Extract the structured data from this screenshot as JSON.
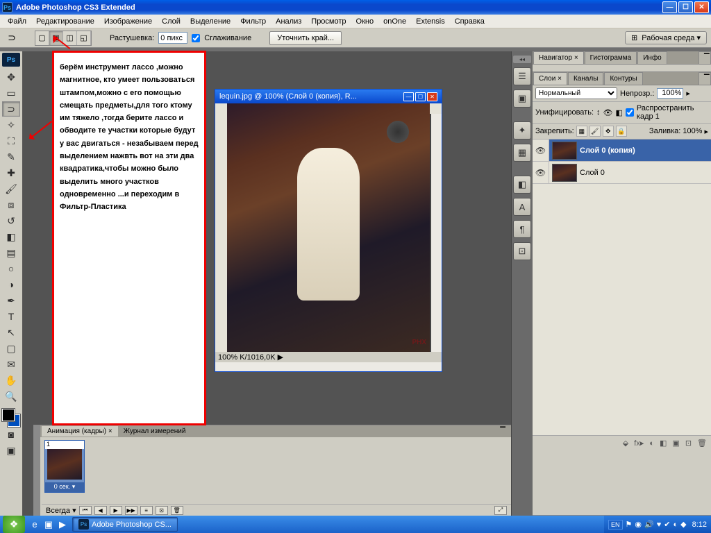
{
  "title": "Adobe Photoshop CS3 Extended",
  "menu": [
    "Файл",
    "Редактирование",
    "Изображение",
    "Слой",
    "Выделение",
    "Фильтр",
    "Анализ",
    "Просмотр",
    "Окно",
    "onOne",
    "Extensis",
    "Справка"
  ],
  "options": {
    "feather_label": "Растушевка:",
    "feather_value": "0 пикс",
    "antialias_label": "Сглаживание",
    "refine_btn": "Уточнить край...",
    "workspace": "Рабочая среда ▾"
  },
  "annotation_text": "берём инструмент лассо ,можно магнитное, кто умеет пользоваться штампом,можно с его помощью смещать предметы,для того ктому им тяжело ,тогда берите лассо и обводите те участки которые будут у вас двигаться - незабываем перед выделением  нажвть вот на эти два квадратика,чтобы можно было выделить много участков одновременно ...и переходим в Фильтр-Пластика",
  "doc": {
    "title": "lequin.jpg @ 100% (Слой 0 (копия), R...",
    "status": "K/1016,0K",
    "watermark": "PHX"
  },
  "nav_panel": {
    "tabs": [
      "Навигатор ×",
      "Гистограмма",
      "Инфо"
    ]
  },
  "layers_panel": {
    "tabs": [
      "Слои ×",
      "Каналы",
      "Контуры"
    ],
    "blend_mode": "Нормальный",
    "opacity_label": "Непрозр.:",
    "opacity_value": "100%",
    "unify_label": "Унифицировать:",
    "propagate_label": "Распространить кадр 1",
    "lock_label": "Закрепить:",
    "fill_label": "Заливка:",
    "fill_value": "100%",
    "layers": [
      {
        "name": "Слой 0 (копия)",
        "active": true
      },
      {
        "name": "Слой 0",
        "active": false
      }
    ],
    "footer_icons": [
      "⬙",
      "fx▸",
      "◐",
      "◧",
      "▣",
      "⊡",
      "🗑"
    ]
  },
  "anim_panel": {
    "tabs": [
      "Анимация (кадры) ×",
      "Журнал измерений"
    ],
    "frame_num": "1",
    "frame_time": "0 сек. ▾",
    "loop": "Всегда ▾"
  },
  "taskbar": {
    "app_label": "Adobe Photoshop CS...",
    "lang": "EN",
    "clock": "8:12"
  }
}
